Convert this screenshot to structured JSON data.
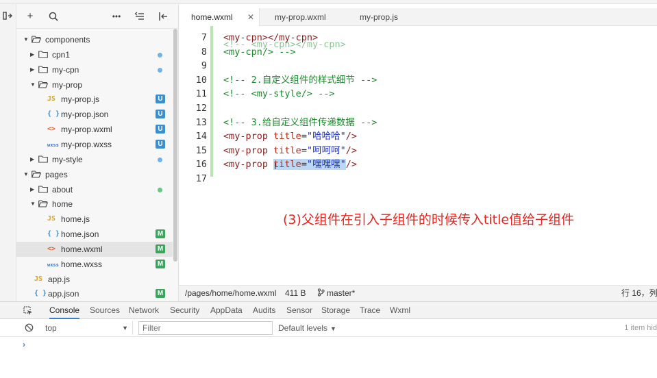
{
  "explorer": {
    "items": [
      {
        "label": "components",
        "kind": "folder",
        "open": true,
        "status": ""
      },
      {
        "label": "cpn1",
        "kind": "folder",
        "open": false,
        "status": "dot-blue"
      },
      {
        "label": "my-cpn",
        "kind": "folder",
        "open": false,
        "status": "dot-blue"
      },
      {
        "label": "my-prop",
        "kind": "folder",
        "open": true,
        "status": ""
      },
      {
        "label": "my-prop.js",
        "kind": "js",
        "status": "U"
      },
      {
        "label": "my-prop.json",
        "kind": "json",
        "status": "U"
      },
      {
        "label": "my-prop.wxml",
        "kind": "wxml",
        "status": "U"
      },
      {
        "label": "my-prop.wxss",
        "kind": "wxss",
        "status": "U"
      },
      {
        "label": "my-style",
        "kind": "folder",
        "open": false,
        "status": "dot-blue"
      },
      {
        "label": "pages",
        "kind": "folder",
        "open": true,
        "status": ""
      },
      {
        "label": "about",
        "kind": "folder",
        "open": false,
        "status": "dot-green"
      },
      {
        "label": "home",
        "kind": "folder",
        "open": true,
        "status": ""
      },
      {
        "label": "home.js",
        "kind": "js",
        "status": ""
      },
      {
        "label": "home.json",
        "kind": "json",
        "status": "M"
      },
      {
        "label": "home.wxml",
        "kind": "wxml",
        "status": "M"
      },
      {
        "label": "home.wxss",
        "kind": "wxss",
        "status": "M"
      },
      {
        "label": "app.js",
        "kind": "js",
        "status": ""
      },
      {
        "label": "app.json",
        "kind": "json",
        "status": "M"
      }
    ],
    "icons": {
      "js": "JS",
      "json": "{ }",
      "wxml": "<>",
      "wxss": "wxss"
    }
  },
  "tabs": [
    {
      "label": "home.wxml",
      "active": true,
      "close": "✕"
    },
    {
      "label": "my-prop.wxml",
      "active": false
    },
    {
      "label": "my-prop.js",
      "active": false
    }
  ],
  "editor": {
    "lines": [
      {
        "n": "7",
        "text": "<my-cpn></my-cpn>"
      },
      {
        "n": "8",
        "text": "<my-cpn/> -->"
      },
      {
        "n": "9",
        "text": ""
      },
      {
        "n": "10",
        "text": "<!-- 2.自定义组件的样式细节 -->"
      },
      {
        "n": "11",
        "text": "<!-- <my-style/> -->"
      },
      {
        "n": "12",
        "text": ""
      },
      {
        "n": "13",
        "text": "<!-- 3.给自定义组件传递数据 -->"
      },
      {
        "n": "14",
        "text": "<my-prop title=\"哈哈哈\"/>"
      },
      {
        "n": "15",
        "text": "<my-prop title=\"呵呵呵\"/>"
      },
      {
        "n": "16",
        "text": "<my-prop title=\"嘿嘿嘿\"/>"
      },
      {
        "n": "17",
        "text": ""
      }
    ],
    "annotation": "(3)父组件在引入子组件的时候传入title值给子组件"
  },
  "statusbar": {
    "path": "/pages/home/home.wxml",
    "size": "411 B",
    "branch": "master*",
    "cursor": "行 16，列"
  },
  "devtools": {
    "tabs": [
      "Console",
      "Sources",
      "Network",
      "Security",
      "AppData",
      "Audits",
      "Sensor",
      "Storage",
      "Trace",
      "Wxml"
    ],
    "active_tab": "Console",
    "context": "top",
    "filter_placeholder": "Filter",
    "levels": "Default levels",
    "items_count": "1 item hid",
    "prompt": "›"
  },
  "colors": {
    "comment": "#1a8a2a",
    "tag": "#8a1c1c",
    "attr": "#b8260f",
    "string": "#1c2fc4",
    "annotation": "#e8241e",
    "badge_u": "#3b8fd0",
    "badge_m": "#3aa55b"
  }
}
